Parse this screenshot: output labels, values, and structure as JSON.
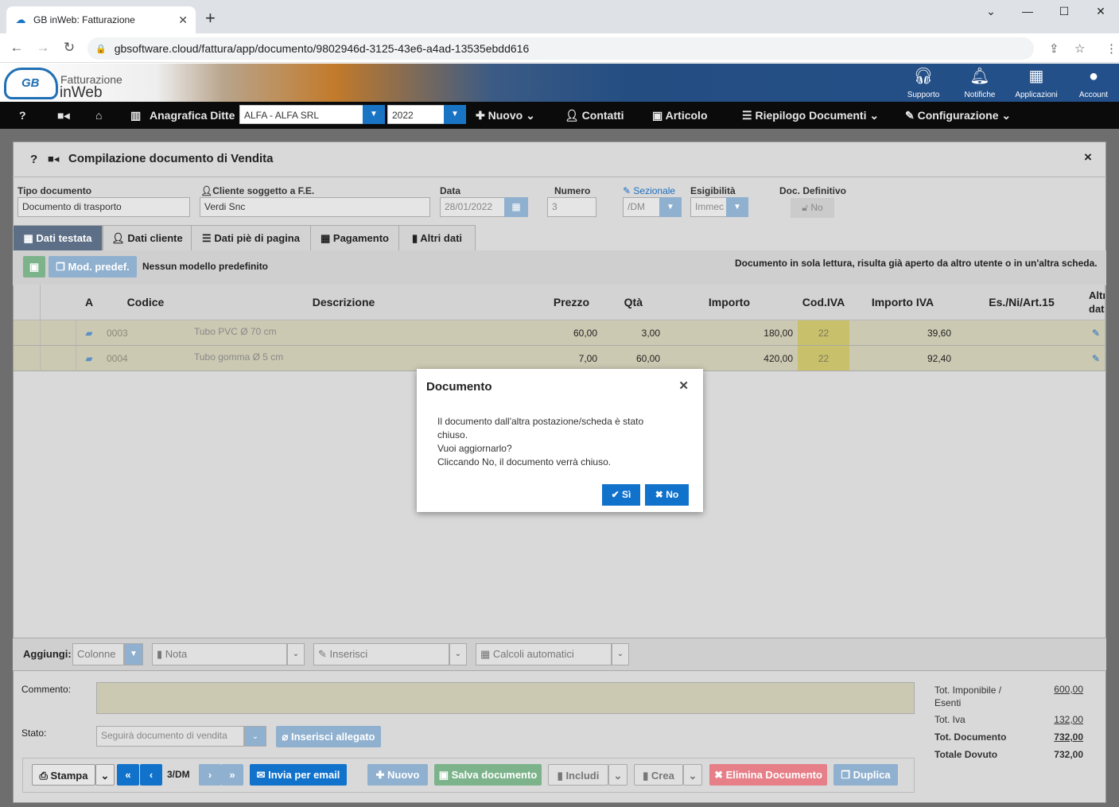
{
  "browser": {
    "tab_title": "GB inWeb: Fatturazione",
    "url": "gbsoftware.cloud/fattura/app/documento/9802946d-3125-43e6-a4ad-13535ebdd616"
  },
  "header": {
    "logo_line1": "Fatturazione",
    "logo_line2": "inWeb",
    "logo_mark": "GB",
    "icons": [
      {
        "label": "Supporto",
        "icon": "headset-icon"
      },
      {
        "label": "Notifiche",
        "icon": "bell-icon"
      },
      {
        "label": "Applicazioni",
        "icon": "grid-icon"
      },
      {
        "label": "Account",
        "icon": "user-circle-icon"
      }
    ]
  },
  "menu": {
    "help": "?",
    "anagrafica": "Anagrafica Ditte",
    "company_select": "ALFA - ALFA SRL",
    "year_select": "2022",
    "nuovo": "Nuovo",
    "contatti": "Contatti",
    "articolo": "Articolo",
    "riepilogo": "Riepilogo Documenti",
    "configurazione": "Configurazione"
  },
  "panel": {
    "title": "Compilazione documento di Vendita",
    "help": "?",
    "close": "×"
  },
  "form": {
    "tipo_label": "Tipo documento",
    "tipo_value": "Documento di trasporto",
    "cliente_label": "Cliente soggetto a F.E.",
    "cliente_value": "Verdi Snc",
    "data_label": "Data",
    "data_value": "28/01/2022",
    "numero_label": "Numero",
    "numero_value": "3",
    "sezionale_label": "Sezionale",
    "sezionale_value": "/DM",
    "esigibilita_label": "Esigibilità",
    "esigibilita_value": "Immec",
    "definitivo_label": "Doc. Definitivo",
    "definitivo_value": "No"
  },
  "tabs": [
    {
      "label": "Dati testata"
    },
    {
      "label": "Dati cliente"
    },
    {
      "label": "Dati piè di pagina"
    },
    {
      "label": "Pagamento"
    },
    {
      "label": "Altri dati"
    }
  ],
  "toolbar": {
    "mod_predef": "Mod. predef.",
    "no_model": "Nessun modello predefinito",
    "readonly_msg": "Documento in sola lettura, risulta già aperto da altro utente o in un'altra scheda."
  },
  "grid": {
    "headers": [
      "",
      "",
      "A",
      "Codice",
      "Descrizione",
      "Prezzo",
      "Qtà",
      "Importo",
      "Cod.IVA",
      "Importo IVA",
      "Es./Ni/Art.15",
      "Altri dati"
    ],
    "rows": [
      {
        "codice": "0003",
        "descrizione": "Tubo PVC Ø 70 cm",
        "prezzo": "60,00",
        "qta": "3,00",
        "importo": "180,00",
        "codiva": "22",
        "importo_iva": "39,60",
        "esenzione": ""
      },
      {
        "codice": "0004",
        "descrizione": "Tubo gomma Ø 5 cm",
        "prezzo": "7,00",
        "qta": "60,00",
        "importo": "420,00",
        "codiva": "22",
        "importo_iva": "92,40",
        "esenzione": ""
      }
    ]
  },
  "aggiungi": {
    "label": "Aggiungi:",
    "colonne": "Colonne",
    "nota": "Nota",
    "inserisci": "Inserisci",
    "calcoli": "Calcoli automatici"
  },
  "footer": {
    "commento_label": "Commento:",
    "stato_label": "Stato:",
    "stato_value": "Seguirà documento di vendita",
    "inserisci_allegato": "Inserisci allegato",
    "stampa": "Stampa",
    "doc_number": "3/DM",
    "invia_email": "Invia per email",
    "nuovo": "Nuovo",
    "salva": "Salva documento",
    "includi": "Includi",
    "crea": "Crea",
    "elimina": "Elimina Documento",
    "duplica": "Duplica"
  },
  "totals": {
    "imponibile_label": "Tot. Imponibile / Esenti",
    "imponibile_value": "600,00",
    "iva_label": "Tot. Iva",
    "iva_value": "132,00",
    "documento_label": "Tot. Documento",
    "documento_value": "732,00",
    "dovuto_label": "Totale Dovuto",
    "dovuto_value": "732,00"
  },
  "modal": {
    "title": "Documento",
    "line1": "Il documento dall'altra postazione/scheda è stato chiuso.",
    "line2": "Vuoi aggiornarlo?",
    "line3": "Cliccando No, il documento verrà chiuso.",
    "yes": "Sì",
    "no": "No"
  }
}
